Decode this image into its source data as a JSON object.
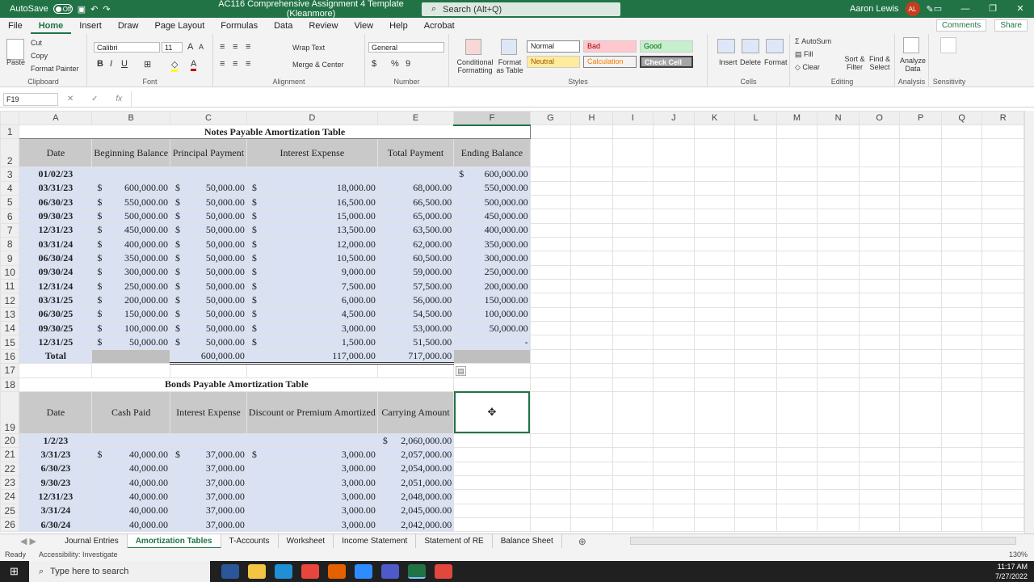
{
  "titlebar": {
    "autosave": "AutoSave",
    "toggle": "Off",
    "doc_title": "AC116 Comprehensive Assignment 4 Template (Kleanmore)",
    "search": "Search (Alt+Q)",
    "user": "Aaron Lewis",
    "initials": "AL"
  },
  "menu": [
    "File",
    "Home",
    "Insert",
    "Draw",
    "Page Layout",
    "Formulas",
    "Data",
    "Review",
    "View",
    "Help",
    "Acrobat"
  ],
  "menu_right": {
    "comments": "Comments",
    "share": "Share"
  },
  "ribbon": {
    "clipboard": {
      "paste": "Paste",
      "cut": "Cut",
      "copy": "Copy",
      "format_painter": "Format Painter",
      "label": "Clipboard"
    },
    "font": {
      "name": "Calibri",
      "size": "11",
      "label": "Font"
    },
    "alignment": {
      "wrap": "Wrap Text",
      "merge": "Merge & Center",
      "label": "Alignment"
    },
    "number": {
      "format": "General",
      "label": "Number"
    },
    "styles": {
      "cond": "Conditional Formatting",
      "table": "Format as Table",
      "normal": "Normal",
      "bad": "Bad",
      "good": "Good",
      "neutral": "Neutral",
      "calculation": "Calculation",
      "check": "Check Cell",
      "label": "Styles"
    },
    "cells": {
      "insert": "Insert",
      "delete": "Delete",
      "format": "Format",
      "label": "Cells"
    },
    "editing": {
      "autosum": "AutoSum",
      "fill": "Fill",
      "clear": "Clear",
      "sort": "Sort & Filter",
      "find": "Find & Select",
      "label": "Editing"
    },
    "analysis": {
      "analyze": "Analyze Data",
      "label": "Analysis"
    },
    "sensitivity": {
      "label": "Sensitivity"
    }
  },
  "formula_bar": {
    "name_box": "F19",
    "content": ""
  },
  "columns": [
    "A",
    "B",
    "C",
    "D",
    "E",
    "F",
    "G",
    "H",
    "I",
    "J",
    "K",
    "L",
    "M",
    "N",
    "O",
    "P",
    "Q",
    "R"
  ],
  "notes": {
    "title": "Notes Payable Amortization Table",
    "headers": [
      "Date",
      "Beginning Balance",
      "Principal Payment",
      "Interest Expense",
      "Total Payment",
      "Ending Balance"
    ],
    "rows": [
      [
        "01/02/23",
        "",
        "",
        "",
        "",
        "600,000.00"
      ],
      [
        "03/31/23",
        "600,000.00",
        "50,000.00",
        "18,000.00",
        "68,000.00",
        "550,000.00"
      ],
      [
        "06/30/23",
        "550,000.00",
        "50,000.00",
        "16,500.00",
        "66,500.00",
        "500,000.00"
      ],
      [
        "09/30/23",
        "500,000.00",
        "50,000.00",
        "15,000.00",
        "65,000.00",
        "450,000.00"
      ],
      [
        "12/31/23",
        "450,000.00",
        "50,000.00",
        "13,500.00",
        "63,500.00",
        "400,000.00"
      ],
      [
        "03/31/24",
        "400,000.00",
        "50,000.00",
        "12,000.00",
        "62,000.00",
        "350,000.00"
      ],
      [
        "06/30/24",
        "350,000.00",
        "50,000.00",
        "10,500.00",
        "60,500.00",
        "300,000.00"
      ],
      [
        "09/30/24",
        "300,000.00",
        "50,000.00",
        "9,000.00",
        "59,000.00",
        "250,000.00"
      ],
      [
        "12/31/24",
        "250,000.00",
        "50,000.00",
        "7,500.00",
        "57,500.00",
        "200,000.00"
      ],
      [
        "03/31/25",
        "200,000.00",
        "50,000.00",
        "6,000.00",
        "56,000.00",
        "150,000.00"
      ],
      [
        "06/30/25",
        "150,000.00",
        "50,000.00",
        "4,500.00",
        "54,500.00",
        "100,000.00"
      ],
      [
        "09/30/25",
        "100,000.00",
        "50,000.00",
        "3,000.00",
        "53,000.00",
        "50,000.00"
      ],
      [
        "12/31/25",
        "50,000.00",
        "50,000.00",
        "1,500.00",
        "51,500.00",
        "-"
      ]
    ],
    "total": [
      "Total",
      "",
      "600,000.00",
      "117,000.00",
      "717,000.00",
      ""
    ]
  },
  "bonds": {
    "title": "Bonds Payable Amortization Table",
    "headers": [
      "Date",
      "Cash Paid",
      "Interest Expense",
      "Discount or Premium Amortized",
      "Carrying Amount"
    ],
    "rows": [
      [
        "1/2/23",
        "",
        "",
        "",
        "2,060,000.00"
      ],
      [
        "3/31/23",
        "40,000.00",
        "37,000.00",
        "3,000.00",
        "2,057,000.00"
      ],
      [
        "6/30/23",
        "40,000.00",
        "37,000.00",
        "3,000.00",
        "2,054,000.00"
      ],
      [
        "9/30/23",
        "40,000.00",
        "37,000.00",
        "3,000.00",
        "2,051,000.00"
      ],
      [
        "12/31/23",
        "40,000.00",
        "37,000.00",
        "3,000.00",
        "2,048,000.00"
      ],
      [
        "3/31/24",
        "40,000.00",
        "37,000.00",
        "3,000.00",
        "2,045,000.00"
      ],
      [
        "6/30/24",
        "40,000.00",
        "37,000.00",
        "3,000.00",
        "2,042,000.00"
      ]
    ]
  },
  "sheets": [
    "Journal Entries",
    "Amortization Tables",
    "T-Accounts",
    "Worksheet",
    "Income Statement",
    "Statement of RE",
    "Balance Sheet"
  ],
  "status": {
    "ready": "Ready",
    "accessibility": "Accessibility: Investigate",
    "zoom": "130%"
  },
  "taskbar": {
    "search": "Type here to search",
    "time": "11:17 AM",
    "date": "7/27/2022"
  }
}
